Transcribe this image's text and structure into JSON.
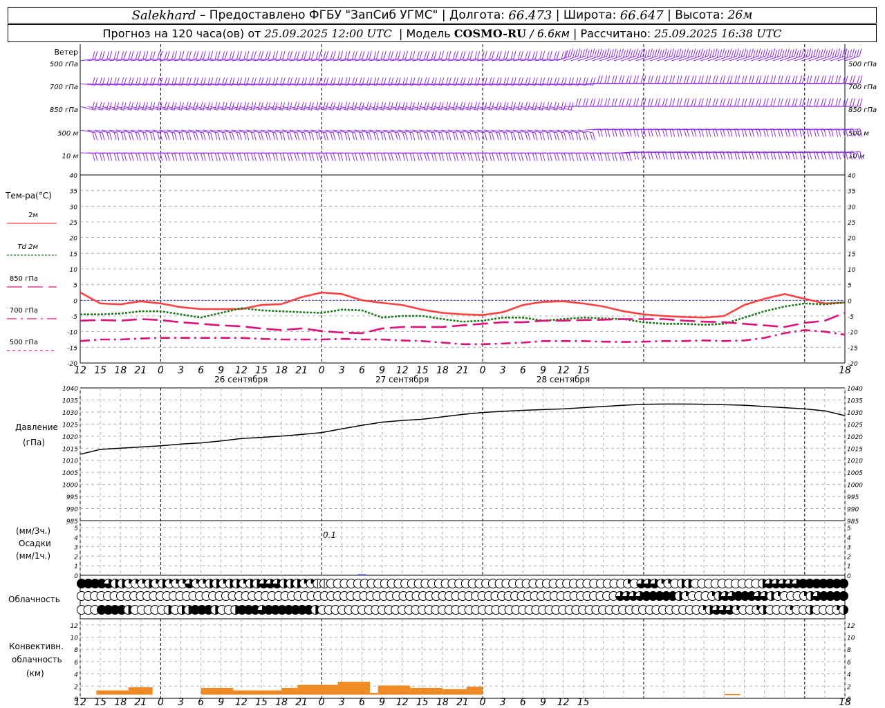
{
  "header": {
    "line1": {
      "station": "Salekhard",
      "provided": "– Предоставлено ФГБУ \"ЗапСиб УГМС\" | Долгота:",
      "lon": "66.473",
      "lat_label": "| Широта:",
      "lat": "66.647",
      "alt_label": "| Высота:",
      "alt": "26м"
    },
    "line2": {
      "prefix": "Прогноз на 120 часа(ов) от",
      "init": "25.09.2025 12:00 UTC",
      "model_label": "| Модель",
      "model": "COSMO-RU",
      "res": "/ 6.6км",
      "calc_label": "| Рассчитано:",
      "calc": "25.09.2025 16:38 UTC"
    }
  },
  "wind_panel": {
    "title": "Ветер",
    "levels": [
      "500 гПа",
      "700 гПа",
      "850 гПа",
      "500 м",
      "10  м"
    ],
    "levels_right": [
      "500 гПа",
      "700 гПа",
      "850 гПа",
      "500 м",
      "10  м"
    ]
  },
  "temp_panel": {
    "title": "Тем-ра(°C)",
    "legend": [
      {
        "label": "2м",
        "color": "#ff4040",
        "dash": ""
      },
      {
        "label": "Td  2м",
        "color": "#1a7a1a",
        "dash": "3,2"
      },
      {
        "label": "850 гПа",
        "color": "#e0107a",
        "dash": "22,8"
      },
      {
        "label": "700 гПа",
        "color": "#e0107a",
        "dash": "14,6,3,6"
      },
      {
        "label": "500 гПа",
        "color": "#e0107a",
        "dash": "4,4"
      }
    ]
  },
  "pressure_panel": {
    "title": "Давление",
    "unit": "(гПа)"
  },
  "precip_panel": {
    "unit1": "(мм/3ч.)",
    "title": "Осадки",
    "unit2": "(мм/1ч.)",
    "annotation": "0.1"
  },
  "cloud_panel": {
    "title": "Облачность"
  },
  "conv_panel": {
    "title1": "Конвективн.",
    "title2": "облачность",
    "unit": "(км)"
  },
  "x_axis": {
    "ticks": [
      "12",
      "15",
      "18",
      "21",
      "0",
      "3",
      "6",
      "9",
      "12",
      "15",
      "18",
      "21",
      "0",
      "3",
      "6",
      "9",
      "12",
      "15",
      "18",
      "21",
      "0",
      "3",
      "6",
      "9",
      "12",
      "15",
      "18"
    ],
    "dates": [
      "26 сентября",
      "27 сентября",
      "28 сентября"
    ]
  },
  "chart_data": [
    {
      "type": "line",
      "title": "Тем-ра(°C)",
      "x": [
        0,
        3,
        6,
        9,
        12,
        15,
        18,
        21,
        24,
        27,
        30,
        33,
        36,
        39,
        42,
        45,
        48,
        51,
        54,
        57,
        60,
        63,
        66,
        69,
        72,
        75,
        78,
        81,
        84,
        87,
        90,
        93,
        96,
        99,
        102,
        105,
        108,
        111,
        114
      ],
      "ylim": [
        -20,
        40
      ],
      "yticks": [
        -20,
        -15,
        -10,
        -5,
        0,
        5,
        10,
        15,
        20,
        25,
        30,
        35,
        40
      ],
      "series": [
        {
          "name": "2м",
          "values": [
            2.5,
            -1,
            -1.3,
            -0.3,
            -1,
            -2.2,
            -2.8,
            -2.8,
            -2.8,
            -1.5,
            -1.2,
            1,
            2.5,
            2,
            0,
            -0.8,
            -1.5,
            -3,
            -4,
            -4.5,
            -4.7,
            -3.8,
            -1.5,
            -0.5,
            -0.3,
            -1,
            -2,
            -3.5,
            -4.5,
            -5,
            -5.3,
            -5.5,
            -5,
            -1.5,
            0.5,
            2,
            0.5,
            -1,
            -0.7
          ]
        },
        {
          "name": "Td  2м",
          "values": [
            -4.5,
            -4.5,
            -4.2,
            -3.5,
            -3.5,
            -4.5,
            -5.5,
            -4,
            -2.5,
            -3.2,
            -3.5,
            -3.8,
            -4,
            -3,
            -3.2,
            -5.5,
            -5,
            -5,
            -6,
            -6.8,
            -6.5,
            -5.5,
            -5.5,
            -6.5,
            -6,
            -5.5,
            -5.8,
            -6,
            -7,
            -7.5,
            -7.5,
            -7.8,
            -7.5,
            -5.5,
            -3.5,
            -2,
            -1,
            -1.3,
            -0.7
          ]
        },
        {
          "name": "850 гПа",
          "values": [
            -6.5,
            -6.3,
            -6.5,
            -6,
            -6.3,
            -7,
            -7.5,
            -8,
            -8.3,
            -9,
            -9.5,
            -9,
            -9.8,
            -10.3,
            -10.5,
            -9,
            -8.5,
            -8.5,
            -8.5,
            -8,
            -7.5,
            -7,
            -7,
            -6.5,
            -6.5,
            -6.3,
            -6.2,
            -6,
            -6,
            -6,
            -6.5,
            -6.8,
            -7,
            -7.5,
            -8,
            -8.5,
            -7.2,
            -6.5,
            -4
          ]
        },
        {
          "name": "700 гПа",
          "values": [
            -13,
            -12.5,
            -12.5,
            -12.2,
            -12,
            -12,
            -12,
            -12,
            -12,
            -12.3,
            -12.5,
            -12.5,
            -12.5,
            -12.3,
            -12.5,
            -12.5,
            -12.8,
            -13,
            -13.5,
            -14,
            -14,
            -13.8,
            -13.5,
            -13,
            -13,
            -13,
            -13.2,
            -13.3,
            -13.2,
            -13,
            -13,
            -12.8,
            -13,
            -12.8,
            -12,
            -10.5,
            -9.5,
            -10,
            -11
          ]
        }
      ]
    },
    {
      "type": "line",
      "title": "Давление",
      "ylabel": "(гПа)",
      "x": [
        0,
        3,
        6,
        9,
        12,
        15,
        18,
        21,
        24,
        27,
        30,
        33,
        36,
        39,
        42,
        45,
        48,
        51,
        54,
        57,
        60,
        63,
        66,
        69,
        72,
        75,
        78,
        81,
        84,
        87,
        90,
        93,
        96,
        99,
        102,
        105,
        108,
        111,
        114
      ],
      "ylim": [
        985,
        1040
      ],
      "yticks": [
        985,
        990,
        995,
        1000,
        1005,
        1010,
        1015,
        1020,
        1025,
        1030,
        1035,
        1040
      ],
      "series": [
        {
          "name": "",
          "values": [
            1012.5,
            1014.5,
            1015,
            1015.5,
            1016,
            1016.7,
            1017.2,
            1018,
            1019,
            1019.5,
            1020,
            1020.7,
            1021.5,
            1023,
            1024.5,
            1025.8,
            1026.5,
            1027,
            1028,
            1029,
            1029.8,
            1030.3,
            1030.7,
            1031,
            1031.3,
            1031.8,
            1032.3,
            1032.8,
            1033.2,
            1033.3,
            1033.3,
            1033.2,
            1033,
            1032.8,
            1032.3,
            1031.8,
            1031.3,
            1030.5,
            1028.5
          ]
        }
      ]
    },
    {
      "type": "bar",
      "title": "Осадки",
      "ylabel": "(мм/3ч.)",
      "ylim": [
        0,
        5
      ],
      "yticks": [
        0,
        1,
        2,
        3,
        4,
        5
      ],
      "categories": [
        "42"
      ],
      "values": [
        0.1
      ]
    },
    {
      "type": "bar",
      "title": "Конвективн. облачность",
      "ylabel": "(км)",
      "ylim": [
        0,
        13
      ],
      "yticks": [
        0,
        2,
        4,
        6,
        8,
        10,
        12
      ],
      "bars": [
        {
          "from": 6,
          "to": 18,
          "base": 0.6,
          "top": 1.3
        },
        {
          "from": 18,
          "to": 27,
          "base": 0.6,
          "top": 1.8
        },
        {
          "from": 45,
          "to": 57,
          "base": 0.6,
          "top": 1.7
        },
        {
          "from": 57,
          "to": 75,
          "base": 0.6,
          "top": 1.3
        },
        {
          "from": 75,
          "to": 81,
          "base": 0.6,
          "top": 1.7
        },
        {
          "from": 81,
          "to": 96,
          "base": 0.6,
          "top": 2.2
        },
        {
          "from": 96,
          "to": 108,
          "base": 0.6,
          "top": 2.7
        },
        {
          "from": 108,
          "to": 111,
          "base": 0.6,
          "top": 0.9
        },
        {
          "from": 111,
          "to": 123,
          "base": 0.6,
          "top": 2.1
        },
        {
          "from": 123,
          "to": 132,
          "base": 0.6,
          "top": 1.7
        },
        {
          "from": 132,
          "to": 135,
          "base": 0.6,
          "top": 1.7
        },
        {
          "from": 135,
          "to": 144,
          "base": 0.6,
          "top": 1.5
        },
        {
          "from": 144,
          "to": 150,
          "base": 0.6,
          "top": 1.9
        },
        {
          "from": 240,
          "to": 246,
          "base": 0.6,
          "top": 0.7
        },
        {
          "from": 429,
          "to": 435,
          "base": 0.6,
          "top": 1.6
        }
      ]
    }
  ],
  "clouds": {
    "step_hours": 1,
    "rows": [
      [
        2,
        2,
        1,
        1,
        0.7,
        0.5,
        0.5,
        0.3,
        0.3,
        0.3,
        0.5,
        0.4,
        0.5,
        0.3,
        0.3,
        0.4,
        0.7,
        0.4,
        0.3,
        0.5,
        0.5,
        0.4,
        0.6,
        0.5,
        0.3,
        0.5,
        0.6,
        0.7,
        0.8,
        0.8,
        0.5,
        0.5,
        0.5,
        0.3,
        0.2,
        0.1,
        0.1,
        0,
        0,
        0,
        0,
        0,
        0,
        0,
        0,
        0,
        0,
        0,
        0,
        0,
        0,
        0,
        0,
        0,
        0,
        0,
        0,
        0,
        0,
        0,
        0,
        0,
        0,
        0,
        0,
        0,
        0,
        0,
        0,
        0,
        0,
        0,
        0,
        0,
        0,
        0,
        0,
        0,
        0,
        0,
        0,
        0.3,
        0,
        0.7,
        0.7,
        0.7,
        0.3,
        0.3,
        0,
        0.5,
        0.5,
        0,
        0,
        0,
        0,
        0,
        0,
        0,
        0,
        0,
        0,
        0.6,
        0.7,
        0.7,
        0.8,
        0.8,
        0.9,
        1,
        1,
        1,
        1,
        1,
        1,
        1
      ],
      [
        0,
        0,
        0,
        0,
        0,
        0,
        0,
        0,
        0,
        0,
        0,
        0,
        0,
        0,
        0,
        0,
        0,
        0,
        0,
        0,
        0,
        0,
        0,
        0,
        0,
        0,
        0,
        0,
        0,
        0,
        0,
        0,
        0,
        0,
        0,
        0,
        0,
        0,
        0,
        0,
        0,
        0,
        0,
        0,
        0,
        0,
        0,
        0,
        0,
        0,
        0,
        0,
        0,
        0,
        0,
        0,
        0,
        0,
        0,
        0,
        0,
        0,
        0,
        0,
        0,
        0,
        0,
        0,
        0,
        0,
        0,
        0,
        0,
        0,
        0,
        0,
        0,
        0,
        0,
        0,
        0,
        0,
        0.7,
        0.9,
        0.9,
        0.8,
        1,
        1,
        1,
        1,
        1,
        0.6,
        0.3,
        0,
        0,
        0,
        0.3,
        0.5,
        0.7,
        0.8,
        1,
        1,
        1,
        0.7,
        0.7,
        0.5,
        0.3,
        0,
        0,
        0,
        0.3,
        0.6,
        0.8,
        1,
        1,
        1,
        1
      ],
      [
        0,
        0,
        0,
        1,
        1,
        1,
        1,
        0.5,
        0,
        0,
        0,
        0,
        0,
        0.5,
        0,
        0.5,
        0.5,
        1,
        1,
        1,
        0.5,
        0,
        0,
        0.5,
        1,
        1,
        1,
        0.7,
        1,
        1,
        1,
        1,
        1,
        1,
        1,
        0.5,
        0,
        0,
        0,
        0,
        0,
        0,
        0,
        0,
        0,
        0,
        0,
        0,
        0,
        0,
        0,
        0,
        0,
        0,
        0,
        0,
        0,
        0,
        0,
        0,
        0,
        0,
        0,
        0,
        0,
        0,
        0,
        0,
        0,
        0,
        0,
        0,
        0,
        0,
        0,
        0,
        0,
        0,
        0,
        0,
        0,
        0,
        0,
        0,
        0,
        0,
        0,
        0,
        0,
        0,
        0,
        0,
        0,
        0.3,
        0.5,
        0.7,
        0.8,
        0.8,
        0.3,
        0,
        0,
        0.3,
        0.5,
        0,
        0,
        0,
        0.3,
        0,
        0,
        0.5,
        0,
        0,
        0,
        0.3,
        0.5
      ]
    ]
  },
  "colors": {
    "wind": "#8a2be2",
    "temp2m": "#ff4040",
    "td2m": "#1a7a1a",
    "upper": "#e0107a",
    "pressure": "#000000",
    "conv": "#f08a24",
    "zero_line": "#3030d0"
  }
}
